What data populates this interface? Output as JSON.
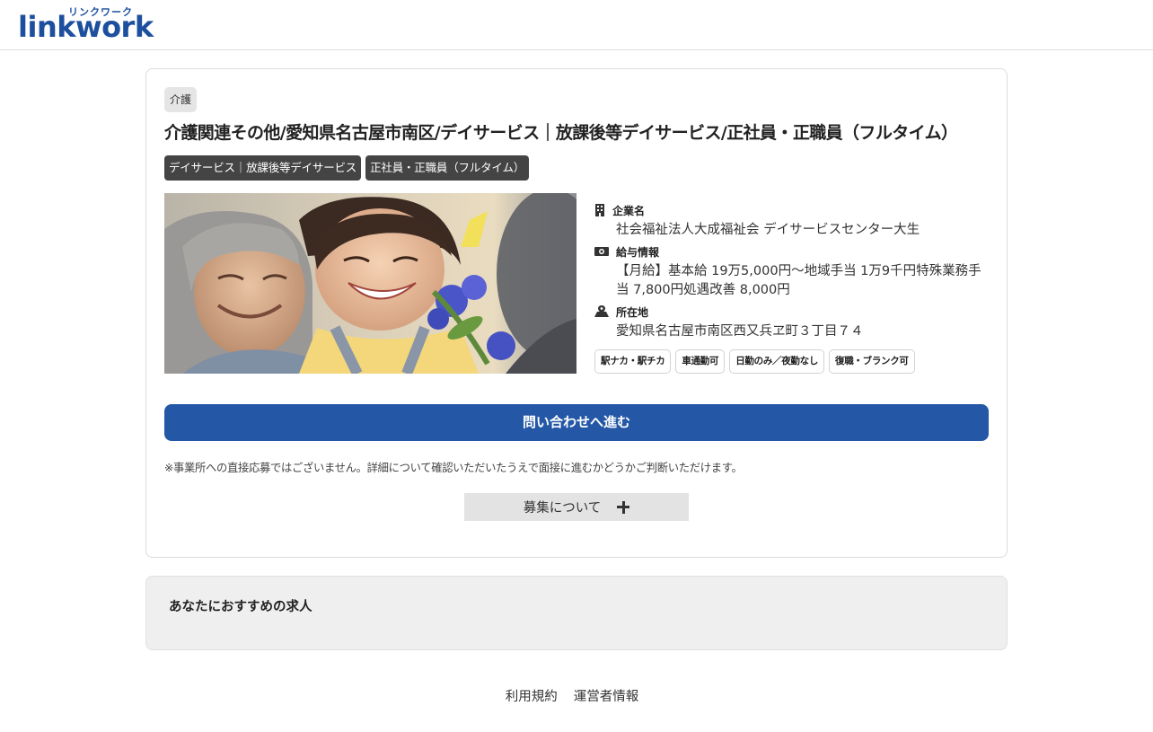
{
  "header": {
    "logo_kana": "リンクワーク",
    "logo_word": "linkwork",
    "brand_color": "#1d4f9f"
  },
  "job": {
    "category": "介護",
    "title": "介護関連その他/愛知県名古屋市南区/デイサービス｜放課後等デイサービス/正社員・正職員（フルタイム）",
    "tags": [
      "デイサービス｜放課後等デイサービス",
      "正社員・正職員（フルタイム）"
    ],
    "company": {
      "label": "企業名",
      "icon": "building-icon",
      "value": "社会福祉法人大成福祉会 デイサービスセンター大生"
    },
    "salary": {
      "label": "給与情報",
      "icon": "money-icon",
      "value": "【月給】基本給 19万5,000円～地域手当 1万9千円特殊業務手当 7,800円処遇改善 8,000円"
    },
    "location": {
      "label": "所在地",
      "icon": "map-pin-icon",
      "value": "愛知県名古屋市南区西又兵ヱ町３丁目７４"
    },
    "features": [
      "駅ナカ・駅チカ",
      "車通勤可",
      "日勤のみ／夜勤なし",
      "復職・ブランク可"
    ],
    "contact_button": "問い合わせへ進む",
    "notice": "※事業所への直接応募ではございません。詳細について確認いただいたうえで面接に進むかどうかご判断いただけます。",
    "accordion_label": "募集について",
    "button_color": "#2458a6"
  },
  "recommend": {
    "title": "あなたにおすすめの求人"
  },
  "footer": {
    "links": [
      "利用規約",
      "運営者情報"
    ]
  }
}
